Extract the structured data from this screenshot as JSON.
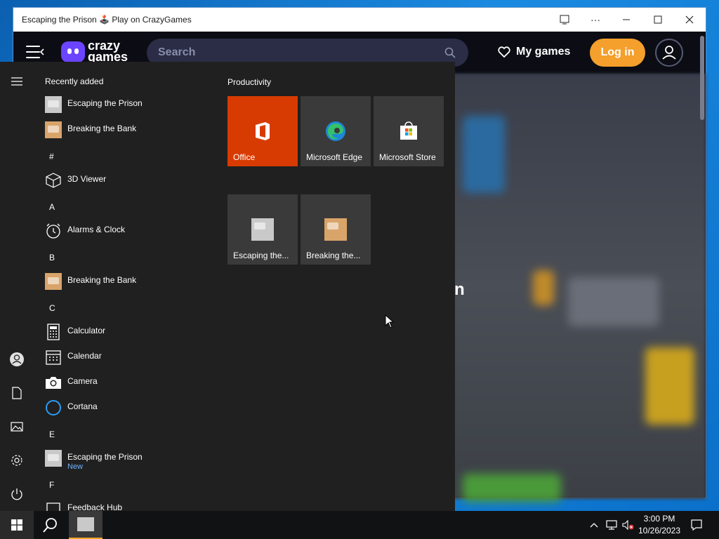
{
  "window": {
    "title": "Escaping the Prison 🕹️ Play on CrazyGames"
  },
  "site": {
    "logo_text_line1": "crazy",
    "logo_text_line2": "games",
    "search_placeholder": "Search",
    "my_games_label": "My games",
    "login_label": "Log in",
    "hero_fragment": "n"
  },
  "start_menu": {
    "recently_added_label": "Recently added",
    "recent": [
      {
        "label": "Escaping the Prison",
        "icon": "game-thumbnail-icon"
      },
      {
        "label": "Breaking the Bank",
        "icon": "game-thumbnail-icon"
      }
    ],
    "sections": {
      "hash": "#",
      "a": "A",
      "b": "B",
      "c": "C",
      "e": "E",
      "f": "F"
    },
    "apps": {
      "viewer3d": "3D Viewer",
      "alarms": "Alarms & Clock",
      "breaking": "Breaking the Bank",
      "calculator": "Calculator",
      "calendar": "Calendar",
      "camera": "Camera",
      "cortana": "Cortana",
      "escaping": "Escaping the Prison",
      "escaping_sub": "New",
      "feedback": "Feedback Hub"
    },
    "tiles_group_label": "Productivity",
    "tiles": [
      {
        "label": "Office",
        "color": "#d83b01"
      },
      {
        "label": "Microsoft Edge"
      },
      {
        "label": "Microsoft Store"
      },
      {
        "label": "Escaping the..."
      },
      {
        "label": "Breaking the..."
      }
    ]
  },
  "taskbar": {
    "time": "3:00 PM",
    "date": "10/26/2023"
  },
  "colors": {
    "accent_orange": "#f59f2c",
    "brand_purple": "#6b44ff",
    "office_red": "#d83b01",
    "start_bg": "#202020"
  }
}
